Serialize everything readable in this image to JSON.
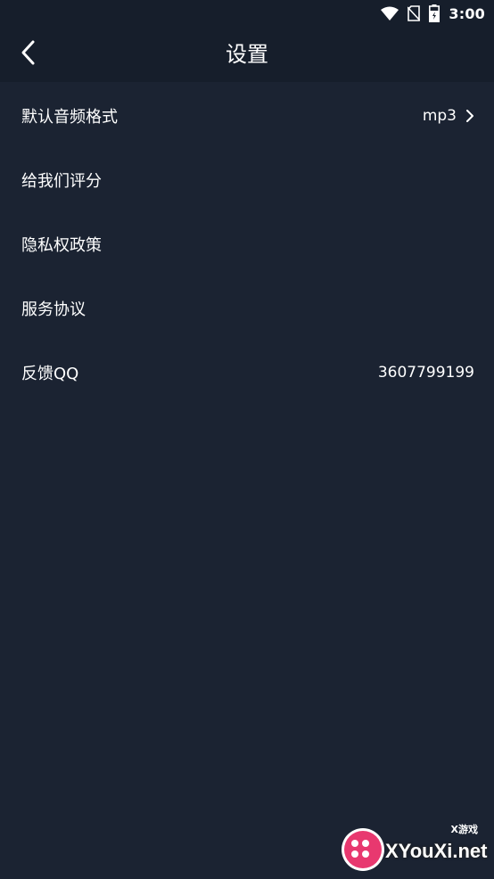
{
  "status_bar": {
    "time": "3:00",
    "icons": [
      "wifi-icon",
      "no-sim-icon",
      "battery-icon"
    ]
  },
  "app_bar": {
    "title": "设置",
    "back_icon": "chevron-left-icon"
  },
  "settings": {
    "items": [
      {
        "label": "默认音频格式",
        "value": "mp3",
        "has_chevron": true
      },
      {
        "label": "给我们评分",
        "value": "",
        "has_chevron": false
      },
      {
        "label": "隐私权政策",
        "value": "",
        "has_chevron": false
      },
      {
        "label": "服务协议",
        "value": "",
        "has_chevron": false
      },
      {
        "label": "反馈QQ",
        "value": "3607799199",
        "has_chevron": false
      }
    ]
  },
  "watermark": {
    "text": "XYouXi.net",
    "sub": "X游戏"
  },
  "colors": {
    "background": "#1b2332",
    "app_bar": "#161e2b",
    "text": "#ffffff",
    "watermark_logo": "#e8386f"
  }
}
